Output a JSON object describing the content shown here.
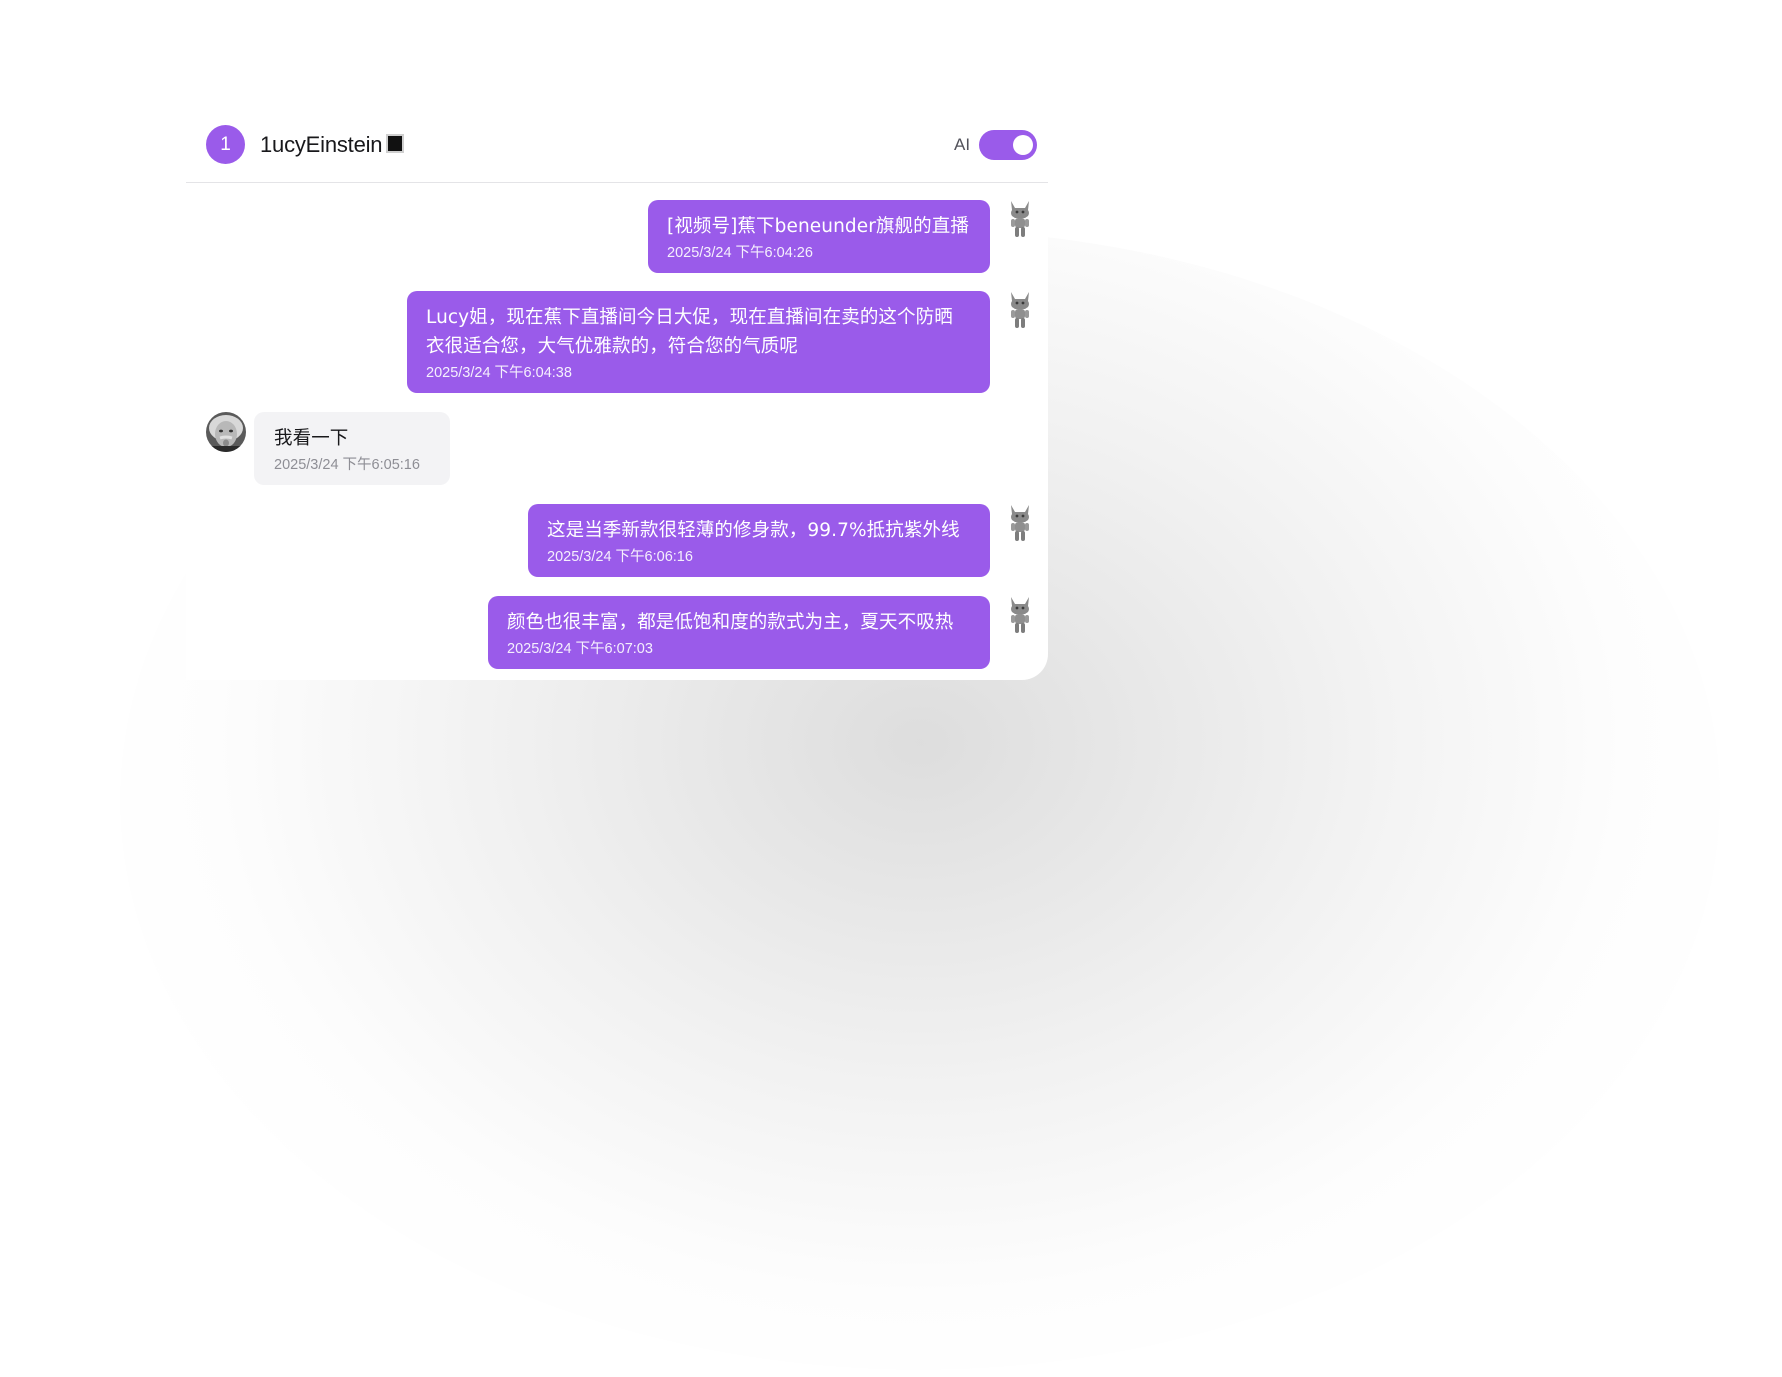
{
  "header": {
    "badge": "1",
    "contact_name": "1ucyEinstein",
    "ai_label": "AI",
    "ai_enabled": true
  },
  "messages": [
    {
      "direction": "out",
      "avatar_icon": "robot-cat-icon",
      "text": "[视频号]蕉下beneunder旗舰的直播",
      "time": "2025/3/24 下午6:04:26"
    },
    {
      "direction": "out",
      "avatar_icon": "robot-cat-icon",
      "text": "Lucy姐，现在蕉下直播间今日大促，现在直播间在卖的这个防晒衣很适合您，大气优雅款的，符合您的气质呢",
      "time": "2025/3/24 下午6:04:38"
    },
    {
      "direction": "in",
      "avatar_icon": "einstein-avatar",
      "text": "我看一下",
      "time": "2025/3/24 下午6:05:16"
    },
    {
      "direction": "out",
      "avatar_icon": "robot-cat-icon",
      "text": "这是当季新款很轻薄的修身款，99.7%抵抗紫外线",
      "time": "2025/3/24 下午6:06:16"
    },
    {
      "direction": "out",
      "avatar_icon": "robot-cat-icon",
      "text": "颜色也很丰富，都是低饱和度的款式为主，夏天不吸热",
      "time": "2025/3/24 下午6:07:03"
    }
  ],
  "colors": {
    "accent": "#9a5bea",
    "incoming_bubble": "#f3f3f5",
    "divider": "#e4e4e7"
  }
}
